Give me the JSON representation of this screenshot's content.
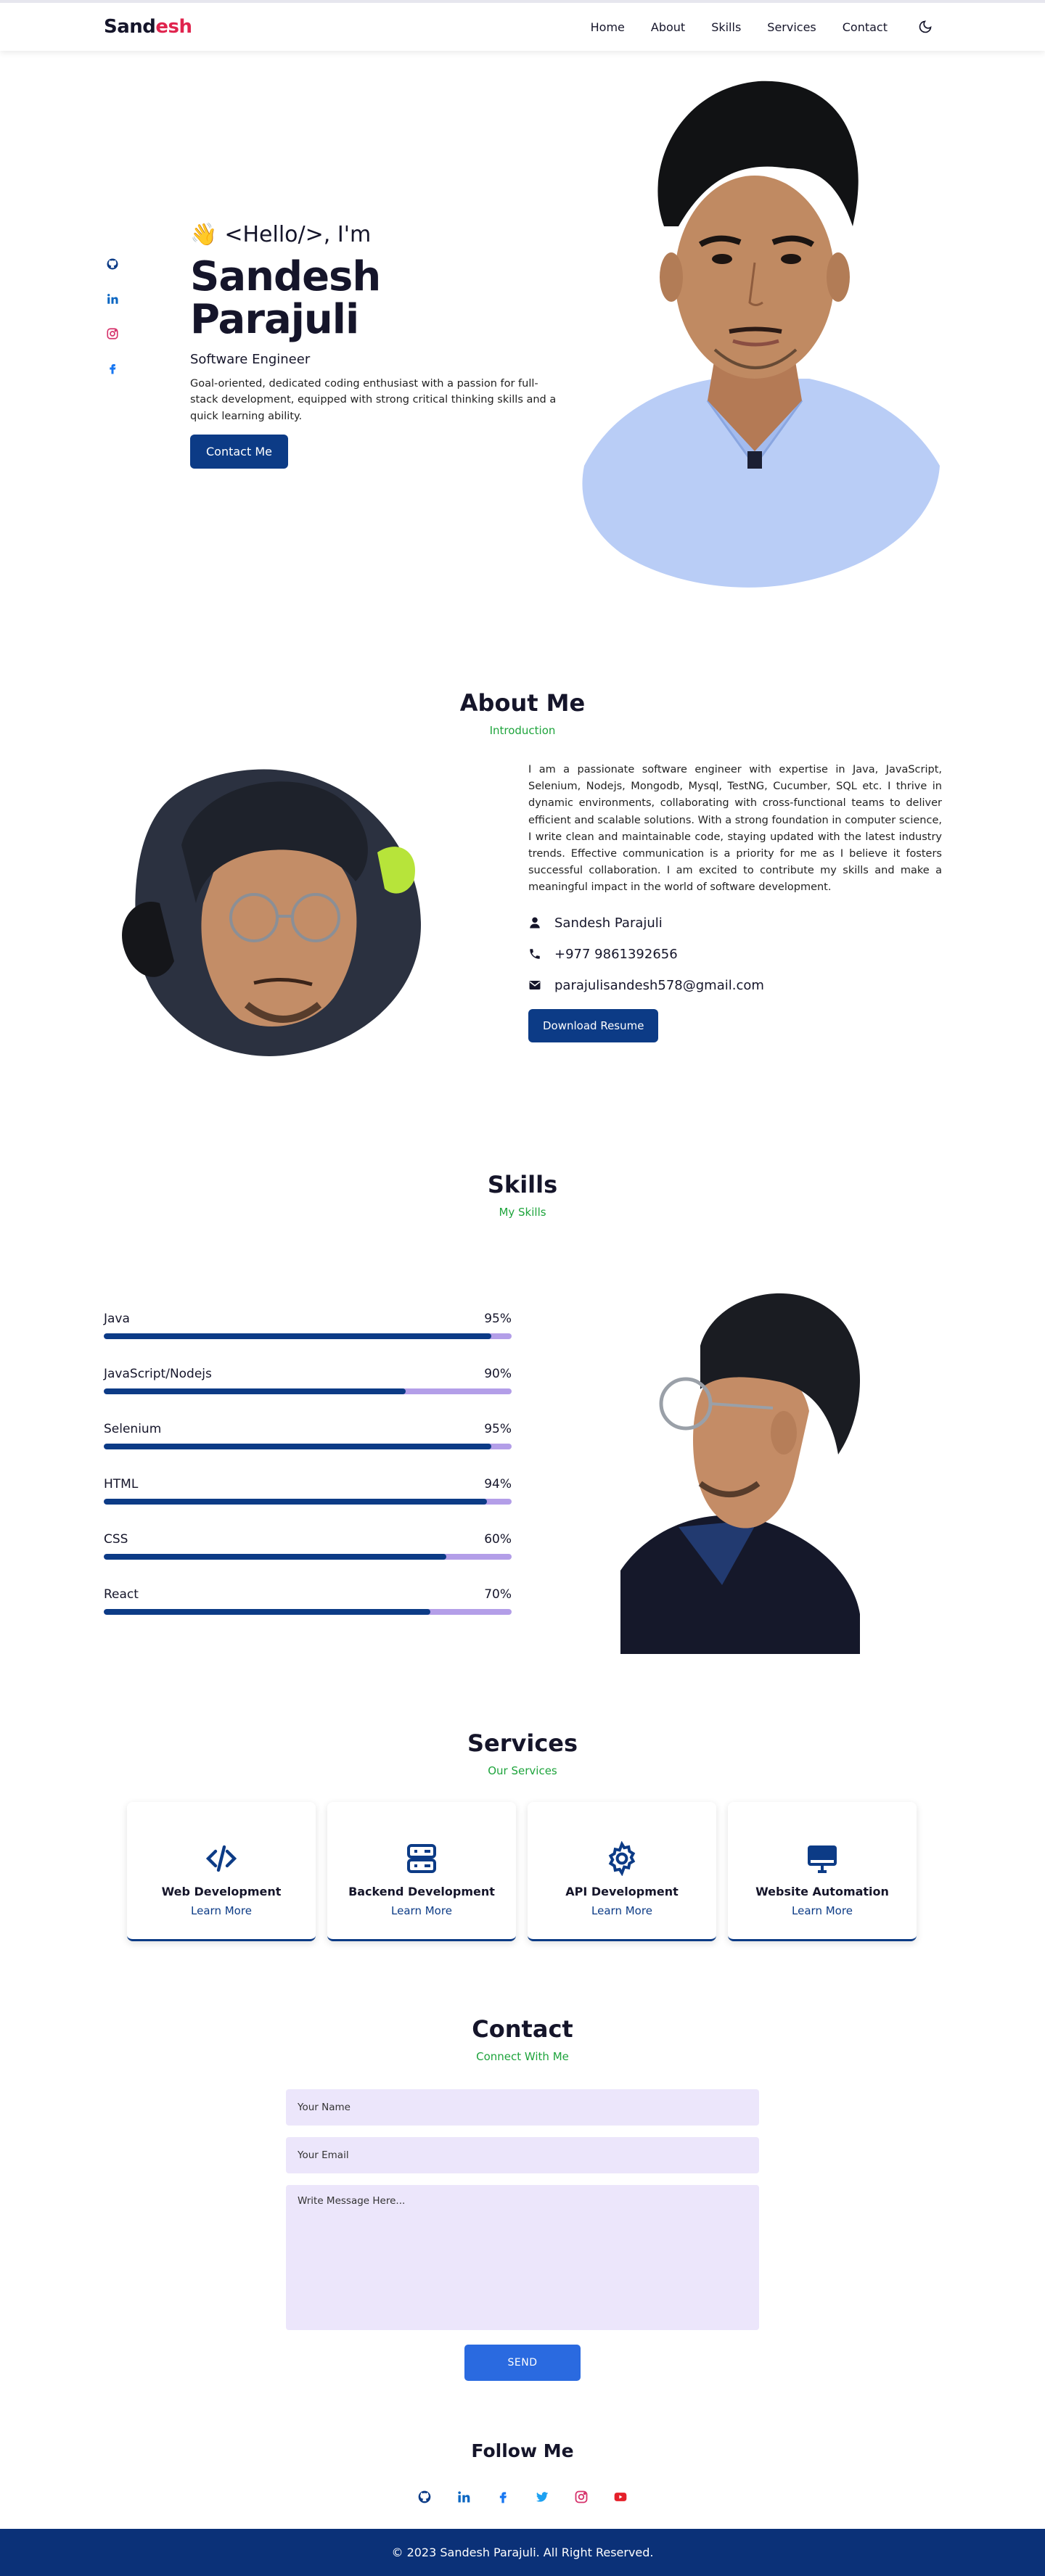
{
  "nav": {
    "logo_part1": "Sand",
    "logo_part2": "esh",
    "links": [
      "Home",
      "About",
      "Skills",
      "Services",
      "Contact"
    ],
    "theme_icon": "moon-icon"
  },
  "hero": {
    "hello": "<Hello/>, I'm",
    "wave": "👋",
    "name": "Sandesh Parajuli",
    "role": "Software Engineer",
    "description": "Goal-oriented, dedicated coding enthusiast with a passion for full-stack development, equipped with strong critical thinking skills and a quick learning ability.",
    "cta": "Contact Me",
    "social_icons": [
      "github-icon",
      "linkedin-icon",
      "instagram-icon",
      "facebook-icon"
    ]
  },
  "about": {
    "title": "About Me",
    "subtitle": "Introduction",
    "paragraph": "I am a passionate software engineer with expertise in Java, JavaScript, Selenium, Nodejs, Mongodb, Mysql, TestNG, Cucumber, SQL etc. I thrive in dynamic environments, collaborating with cross-functional teams to deliver efficient and scalable solutions. With a strong foundation in computer science, I write clean and maintainable code, staying updated with the latest industry trends. Effective communication is a priority for me as I believe it fosters successful collaboration. I am excited to contribute my skills and make a meaningful impact in the world of software development.",
    "name": "Sandesh Parajuli",
    "phone": "+977 9861392656",
    "email": "parajulisandesh578@gmail.com",
    "download": "Download Resume"
  },
  "skills": {
    "title": "Skills",
    "subtitle": "My Skills",
    "items": [
      {
        "name": "Java",
        "label": "95%",
        "value": 0.95
      },
      {
        "name": "JavaScript/Nodejs",
        "label": "90%",
        "value": 0.74
      },
      {
        "name": "Selenium",
        "label": "95%",
        "value": 0.95
      },
      {
        "name": "HTML",
        "label": "94%",
        "value": 0.94
      },
      {
        "name": "CSS",
        "label": "60%",
        "value": 0.84
      },
      {
        "name": "React",
        "label": "70%",
        "value": 0.8
      }
    ]
  },
  "services": {
    "title": "Services",
    "subtitle": "Our Services",
    "items": [
      {
        "title": "Web Development",
        "link": "Learn More",
        "icon": "code-icon"
      },
      {
        "title": "Backend Development",
        "link": "Learn More",
        "icon": "server-icon"
      },
      {
        "title": "API Development",
        "link": "Learn More",
        "icon": "gear-icon"
      },
      {
        "title": "Website Automation",
        "link": "Learn More",
        "icon": "monitor-icon"
      }
    ]
  },
  "contact": {
    "title": "Contact",
    "subtitle": "Connect With Me",
    "name_placeholder": "Your Name",
    "email_placeholder": "Your Email",
    "message_placeholder": "Write Message Here...",
    "send": "SEND"
  },
  "follow": {
    "title": "Follow Me",
    "icons": [
      "github-icon",
      "linkedin-icon",
      "facebook-icon",
      "twitter-icon",
      "instagram-icon",
      "youtube-icon"
    ]
  },
  "footer": {
    "text": "© 2023 Sandesh Parajuli. All Right Reserved."
  },
  "colors": {
    "brand": "#0c3b86",
    "accent_red": "#e0244e",
    "green": "#1ea43c",
    "bar_track": "#b39ee8",
    "field_bg": "#ece6fb",
    "send": "#2a6ae0",
    "footer": "#0b3178"
  }
}
